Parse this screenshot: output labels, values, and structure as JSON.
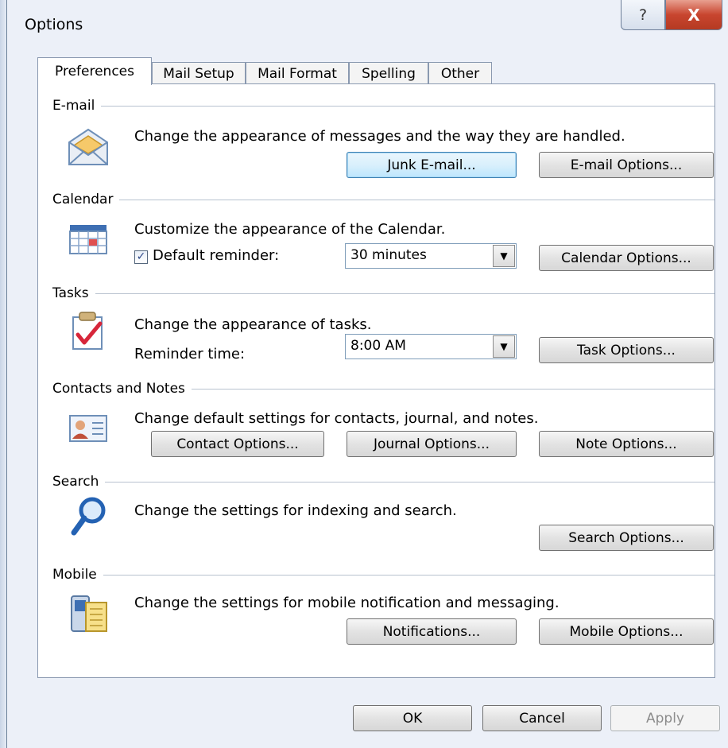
{
  "window": {
    "title": "Options",
    "help_label": "?",
    "close_label": "X"
  },
  "tabs": [
    {
      "label": "Preferences"
    },
    {
      "label": "Mail Setup"
    },
    {
      "label": "Mail Format"
    },
    {
      "label": "Spelling"
    },
    {
      "label": "Other"
    }
  ],
  "email": {
    "heading": "E-mail",
    "description": "Change the appearance of messages and the way they are handled.",
    "junk_button": "Junk E-mail...",
    "options_button": "E-mail Options..."
  },
  "calendar": {
    "heading": "Calendar",
    "description": "Customize the appearance of the Calendar.",
    "reminder_label": "Default reminder:",
    "reminder_checked": true,
    "reminder_value": "30 minutes",
    "options_button": "Calendar Options..."
  },
  "tasks": {
    "heading": "Tasks",
    "description": "Change the appearance of tasks.",
    "reminder_label": "Reminder time:",
    "reminder_value": "8:00 AM",
    "options_button": "Task Options..."
  },
  "contacts": {
    "heading": "Contacts and Notes",
    "description": "Change default settings for contacts, journal, and notes.",
    "contact_button": "Contact Options...",
    "journal_button": "Journal Options...",
    "note_button": "Note Options..."
  },
  "search": {
    "heading": "Search",
    "description": "Change the settings for indexing and search.",
    "options_button": "Search Options..."
  },
  "mobile": {
    "heading": "Mobile",
    "description": "Change the settings for mobile notification and messaging.",
    "notifications_button": "Notifications...",
    "options_button": "Mobile Options..."
  },
  "footer": {
    "ok": "OK",
    "cancel": "Cancel",
    "apply": "Apply"
  },
  "colors": {
    "accent": "#3c7fb1",
    "close": "#c8452f",
    "panel_bg": "#ecf0f8"
  }
}
